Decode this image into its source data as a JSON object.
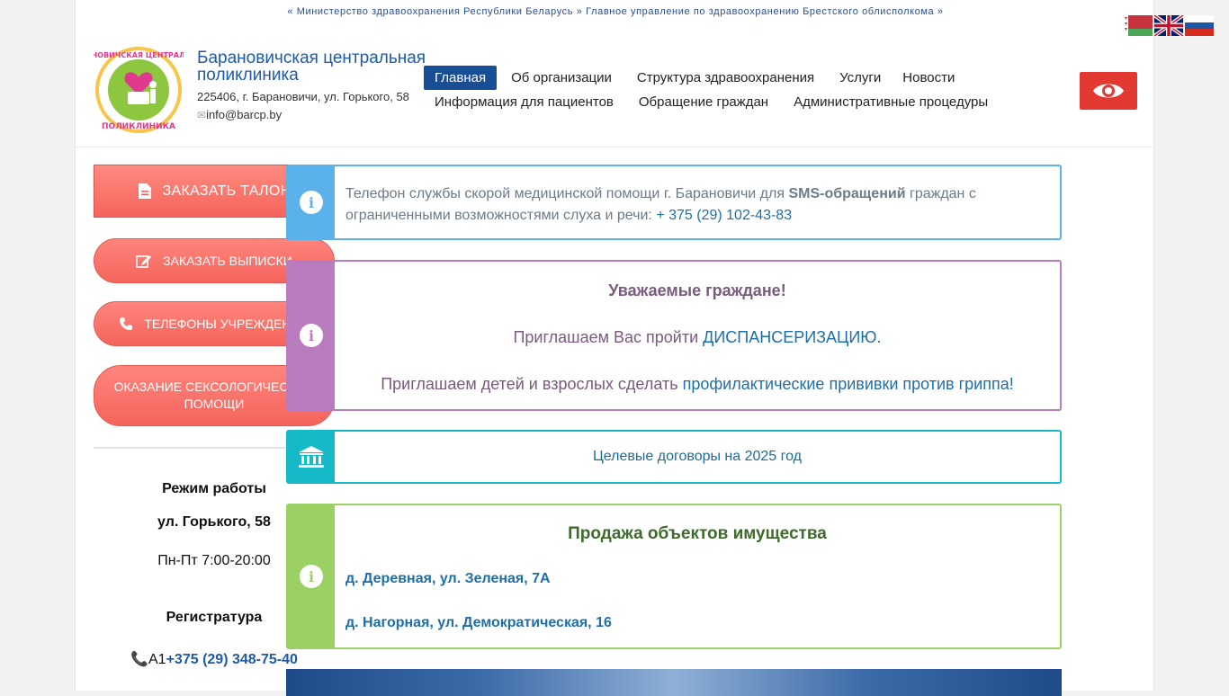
{
  "header": {
    "top_line": "« Министерство здравоохранения Республики Беларусь » Главное управление по здравоохранению Брестского облисполкома »",
    "brand_name": "Барановичская центральная поликлиника",
    "address": "225406, г. Барановичи, ул. Горького, 58",
    "email": "info@barcp.by",
    "logo_text_top": "БАРАНОВИЧСКАЯ ЦЕНТРАЛЬНАЯ",
    "logo_text_bottom": "ПОЛИКЛИНИКА",
    "languages": [
      "Беларуская",
      "English",
      "Русский"
    ]
  },
  "nav": {
    "row1": [
      "Главная",
      "Об организации",
      "Структура здравоохранения",
      "Услуги",
      "Новости"
    ],
    "row2": [
      "Информация для пациентов",
      "Обращение граждан",
      "Административные процедуры"
    ]
  },
  "sidebar": {
    "order_ticket": "Заказать талон",
    "order_extracts": "Заказать выписки",
    "phones": "Телефоны учреждений",
    "sexology": "Оказание сексологической помощи",
    "hours_title": "Режим работы",
    "hours_address": "ул. Горького, 58",
    "hours_value": "Пн-Пт 7:00-20:00",
    "registry_title": "Регистратура",
    "registry_prefix": "А1",
    "registry_phone": "+375 (29) 348-75-40"
  },
  "main": {
    "sms_text_1": "Телефон службы скорой медицинской помощи г. Барановичи для",
    "sms_bold": "SMS-обращений",
    "sms_text_2": "граждан с ограниченными возможностями слуха и речи:",
    "sms_phone": "+ 375 (29) 102-43-83",
    "citizens_title": "Уважаемые граждане!",
    "disp_text": "Приглашаем Вас пройти",
    "disp_link": "ДИСПАНСЕРИЗАЦИЮ",
    "disp_dot": ".",
    "vacc_text": "Приглашаем детей и взрослых сделать",
    "vacc_link": "профилактические прививки против гриппа!",
    "contracts": "Целевые договоры на 2025 год",
    "property_title": "Продажа объектов имущества",
    "property_1": "д. Деревная, ул. Зеленая, 7А",
    "property_2": "д. Нагорная, ул. Демократическая, 16"
  },
  "colors": {
    "nav_active": "#174e96",
    "accent_red": "#e23a32",
    "button_coral": "#f4645c",
    "info_blue": "#5bb1ea",
    "info_purple": "#b97dbf",
    "info_cyan": "#16b9c8",
    "info_green": "#9bd164"
  }
}
